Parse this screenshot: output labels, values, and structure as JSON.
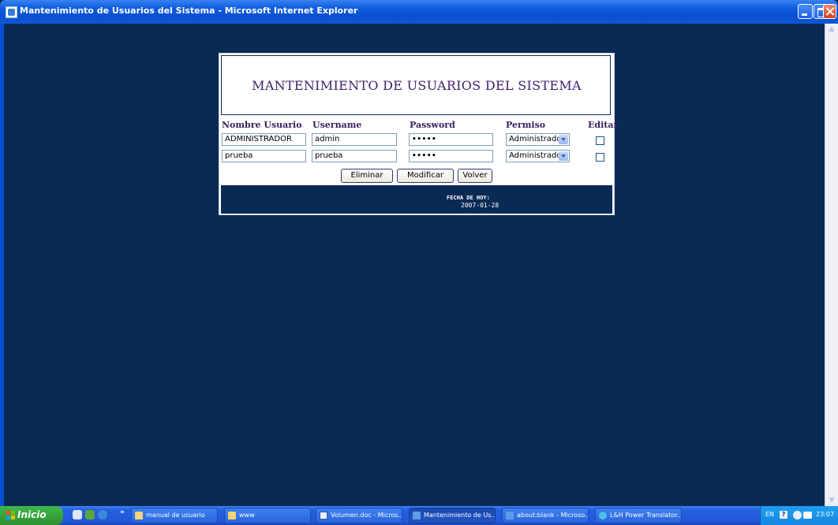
{
  "window": {
    "title": "Mantenimiento de Usuarios del Sistema - Microsoft Internet Explorer"
  },
  "page": {
    "title": "MANTENIMIENTO DE USUARIOS DEL SISTEMA",
    "columns": [
      "Nombre Usuario",
      "Username",
      "Password",
      "Permiso",
      "Editar"
    ],
    "rows": [
      {
        "nombre": "ADMINISTRADOR",
        "username": "admin",
        "password_mask": "•••••",
        "permiso": "Administrador",
        "editar": false
      },
      {
        "nombre": "prueba",
        "username": "prueba",
        "password_mask": "•••••",
        "permiso": "Administrador",
        "editar": false
      }
    ],
    "buttons": {
      "delete": "Eliminar",
      "modify": "Modificar",
      "back": "Volver"
    },
    "footer": {
      "date_label": "FECHA DE HOY:",
      "date_value": "2007-01-28"
    }
  },
  "taskbar": {
    "start_label": "Inicio",
    "more_label": "»",
    "tasks": [
      {
        "label": "manual de usuario",
        "icon": "folder-icon"
      },
      {
        "label": "www",
        "icon": "folder-icon"
      },
      {
        "label": "Volumen.doc - Micros...",
        "icon": "word-doc-icon"
      },
      {
        "label": "Mantenimiento de Us...",
        "icon": "ie-window-icon"
      },
      {
        "label": "about:blank - Microso...",
        "icon": "ie-window-icon"
      },
      {
        "label": "L&H Power Translator...",
        "icon": "translator-icon"
      }
    ],
    "tray": {
      "lang": "EN",
      "help": "?",
      "time": "23:07"
    }
  },
  "colors": {
    "page_bg": "#0a2a56",
    "title_text": "#40206a",
    "titlebar_blue": "#0a4fd0",
    "start_green": "#3fb94b"
  }
}
